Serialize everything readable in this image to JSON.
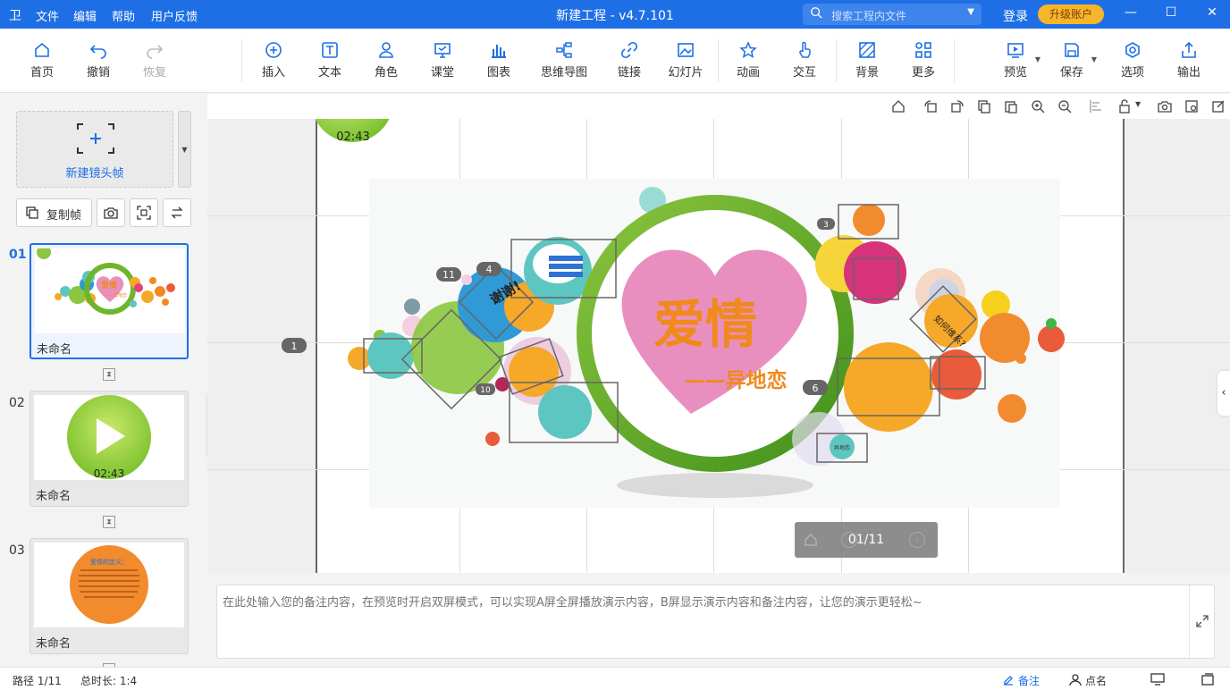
{
  "titlebar": {
    "logo": "卫",
    "menus": [
      "文件",
      "编辑",
      "帮助",
      "用户反馈"
    ],
    "title": "新建工程 - v4.7.101",
    "search_placeholder": "搜索工程内文件",
    "login": "登录",
    "upgrade": "升级账户"
  },
  "toolbar": {
    "home": "首页",
    "undo": "撤销",
    "redo": "恢复",
    "insert": "插入",
    "text": "文本",
    "role": "角色",
    "class": "课堂",
    "chart": "图表",
    "mindmap": "思维导图",
    "link": "链接",
    "slide": "幻灯片",
    "animation": "动画",
    "interact": "交互",
    "background": "背景",
    "more": "更多",
    "preview": "预览",
    "save": "保存",
    "options": "选项",
    "export": "输出"
  },
  "left": {
    "new_frame": "新建镜头帧",
    "copy_frame": "复制帧",
    "slides": [
      {
        "num": "01",
        "name": "未命名",
        "thumb_title": "爱情",
        "thumb_subtitle": "——异地恋"
      },
      {
        "num": "02",
        "name": "未命名",
        "thumb_time": "02:43"
      },
      {
        "num": "03",
        "name": "未命名",
        "thumb_title": "爱情的定义：",
        "thumb_body": "爱情是人与人之间的强烈的依恋、亲近、向往，以及竭尽所能为对方付出的情感。它是彼此间互相吸引的结果，是双方在精神和物质上的一种结合。"
      }
    ]
  },
  "stage": {
    "timer": "02:43",
    "title": "爱情",
    "subtitle": "——异地恋",
    "thanks": "谢谢!",
    "contact": "如何维系?",
    "tag_label": "异地恋",
    "path_labels": [
      "1",
      "3",
      "4",
      "6",
      "10",
      "11"
    ],
    "pager": "01/11"
  },
  "notes": {
    "placeholder": "在此处输入您的备注内容，在预览时开启双屏模式，可以实现A屏全屏播放演示内容，B屏显示演示内容和备注内容，让您的演示更轻松~"
  },
  "status": {
    "path": "路径 1/11",
    "duration": "总时长: 1:4",
    "notes": "备注",
    "rollcall": "点名"
  },
  "colors": {
    "accent": "#1e6fe6",
    "upgrade": "#f7b52c",
    "title_orange": "#f08a1c",
    "ring_green": "#6fb52c",
    "heart_pink": "#e98fbf"
  }
}
